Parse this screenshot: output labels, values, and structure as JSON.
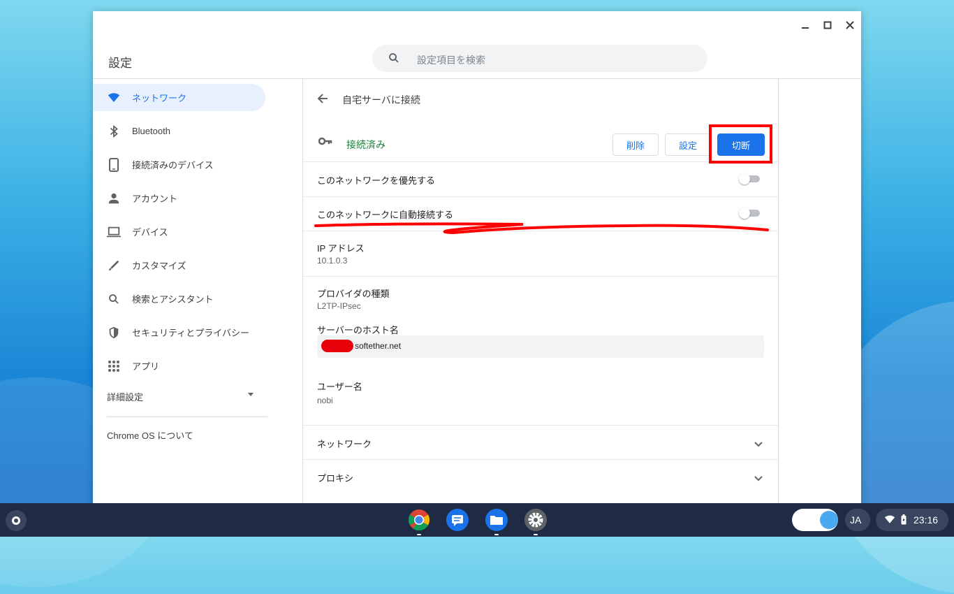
{
  "window": {
    "title": "設定"
  },
  "search": {
    "placeholder": "設定項目を検索"
  },
  "sidebar": {
    "items": [
      {
        "label": "ネットワーク",
        "icon": "wifi-icon",
        "active": true
      },
      {
        "label": "Bluetooth",
        "icon": "bluetooth-icon"
      },
      {
        "label": "接続済みのデバイス",
        "icon": "phone-icon"
      },
      {
        "label": "アカウント",
        "icon": "person-icon"
      },
      {
        "label": "デバイス",
        "icon": "laptop-icon"
      },
      {
        "label": "カスタマイズ",
        "icon": "brush-icon"
      },
      {
        "label": "検索とアシスタント",
        "icon": "search-icon"
      },
      {
        "label": "セキュリティとプライバシー",
        "icon": "shield-icon"
      },
      {
        "label": "アプリ",
        "icon": "apps-grid-icon"
      }
    ],
    "advanced": "詳細設定",
    "about": "Chrome OS について"
  },
  "detail": {
    "title": "自宅サーバに接続",
    "status": "接続済み",
    "buttons": {
      "delete": "削除",
      "settings": "設定",
      "disconnect": "切断"
    },
    "prefer_label": "このネットワークを優先する",
    "autoconnect_label": "このネットワークに自動接続する",
    "ip_label": "IP アドレス",
    "ip_value": "10.1.0.3",
    "provider_label": "プロバイダの種類",
    "provider_value": "L2TP-IPsec",
    "host_label": "サーバーのホスト名",
    "host_value": "softether.net",
    "username_label": "ユーザー名",
    "username_value": "nobi",
    "network_section": "ネットワーク",
    "proxy_section": "プロキシ"
  },
  "toggles": {
    "prefer": false,
    "autoconnect": false
  },
  "shelf": {
    "apps": [
      "chrome-icon",
      "messages-icon",
      "files-icon",
      "settings-icon"
    ],
    "ime": "JA",
    "time": "23:16"
  },
  "colors": {
    "accent": "#1a73e8",
    "connected": "#188038",
    "annotation": "#ff0000",
    "shelf": "#1f2a44"
  }
}
